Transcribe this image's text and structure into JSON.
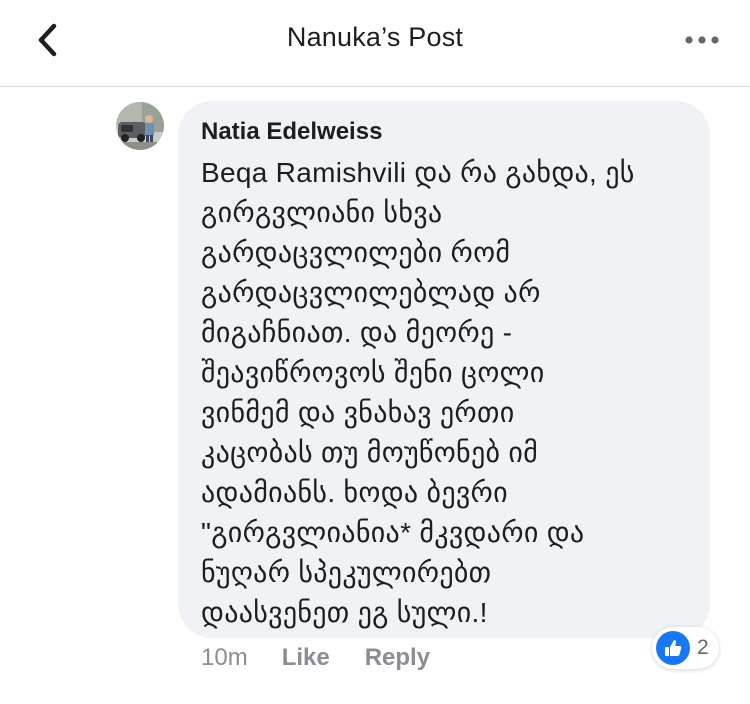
{
  "header": {
    "title": "Nanuka’s Post",
    "back_icon": "chevron-left-icon",
    "more_icon": "more-horizontal-icon"
  },
  "comment": {
    "author": "Natia Edelweiss",
    "text": "Beqa Ramishvili და რა გახდა, ეს\nგირგვლიანი სხვა\nგარდაცვლილები რომ\nგარდაცვლილებლად არ\nმიგაჩნიათ. და მეორე -\nშეავიწროვოს შენი ცოლი\nვინმემ და ვნახავ ერთი\nკაცობას თუ მოუწონებ იმ\nადამიანს. ხოდა ბევრი\n\"გირგვლიანია* მკვდარი და\nნუღარ სპეკულირებთ\nდაასვენეთ ეგ სული.!",
    "time": "10m",
    "like_label": "Like",
    "reply_label": "Reply",
    "reaction_count": "2",
    "reaction_icon": "thumbs-up-icon"
  },
  "colors": {
    "bubble": "#f0f2f5",
    "accent": "#1877f2",
    "muted": "#8a8d91"
  }
}
